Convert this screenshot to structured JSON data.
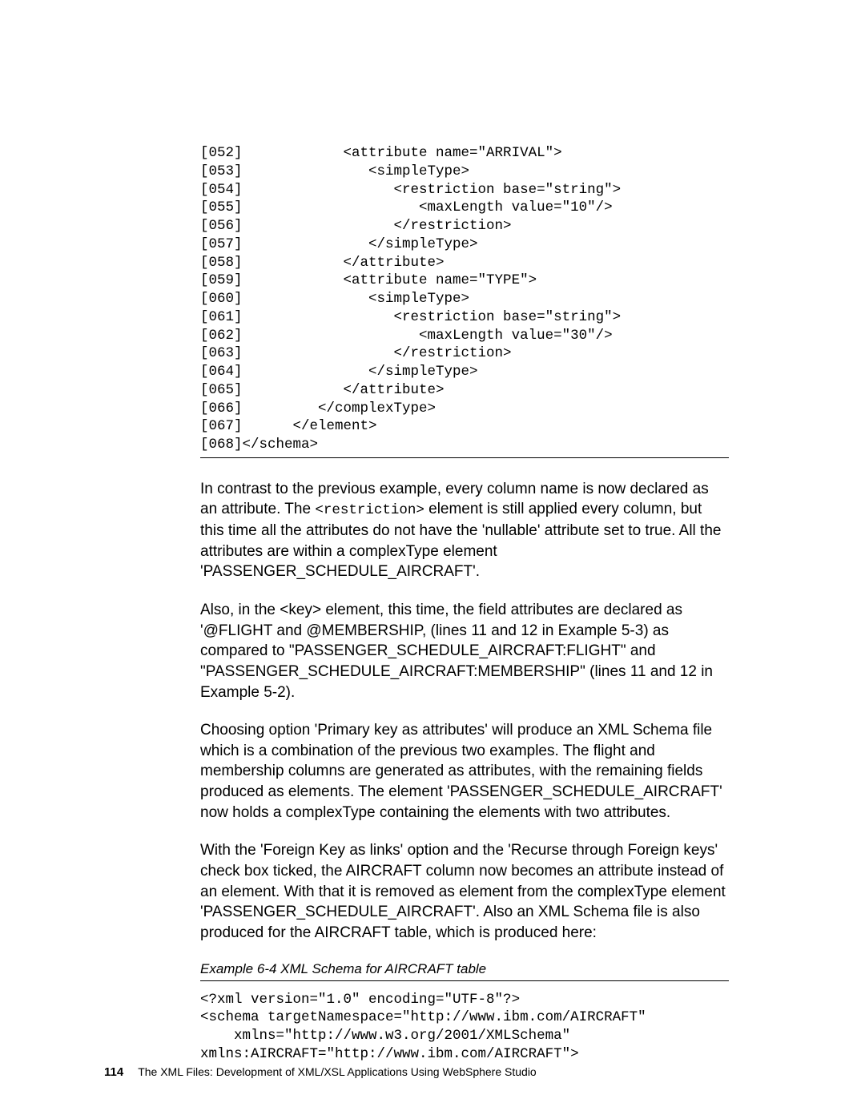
{
  "code1": "[052]            <attribute name=\"ARRIVAL\">\n[053]               <simpleType>\n[054]                  <restriction base=\"string\">\n[055]                     <maxLength value=\"10\"/>\n[056]                  </restriction>\n[057]               </simpleType>\n[058]            </attribute>\n[059]            <attribute name=\"TYPE\">\n[060]               <simpleType>\n[061]                  <restriction base=\"string\">\n[062]                     <maxLength value=\"30\"/>\n[063]                  </restriction>\n[064]               </simpleType>\n[065]            </attribute>\n[066]         </complexType>\n[067]      </element>\n[068]</schema>",
  "p1a": "In contrast to the previous example, every column name is now declared as an attribute. The ",
  "p1_code": "<restriction>",
  "p1b": " element is still applied every column, but this time all the attributes do not have the 'nullable' attribute set to true. All the attributes are within a complexType element 'PASSENGER_SCHEDULE_AIRCRAFT'.",
  "p2": "Also, in the <key> element, this time, the field attributes are declared as '@FLIGHT and @MEMBERSHIP, (lines 11 and 12 in Example 5-3) as compared to \"PASSENGER_SCHEDULE_AIRCRAFT:FLIGHT\" and \"PASSENGER_SCHEDULE_AIRCRAFT:MEMBERSHIP\" (lines 11 and 12 in Example 5-2).",
  "p3": "Choosing option 'Primary key as attributes' will produce an XML Schema file which is a combination of the previous two examples. The flight and membership columns are generated as attributes, with the remaining fields produced as elements. The element 'PASSENGER_SCHEDULE_AIRCRAFT' now holds a complexType containing the elements with two attributes.",
  "p4": "With the 'Foreign Key as links' option and the 'Recurse through Foreign keys' check box ticked, the AIRCRAFT column now becomes an attribute instead of an element. With that it is removed as element from the complexType element 'PASSENGER_SCHEDULE_AIRCRAFT'. Also an XML Schema file is also produced for the AIRCRAFT table, which is produced here:",
  "example_caption": "Example 6-4   XML Schema for AIRCRAFT table",
  "code2": "<?xml version=\"1.0\" encoding=\"UTF-8\"?>\n<schema targetNamespace=\"http://www.ibm.com/AIRCRAFT\"\n    xmlns=\"http://www.w3.org/2001/XMLSchema\"\nxmlns:AIRCRAFT=\"http://www.ibm.com/AIRCRAFT\">",
  "footer": {
    "page": "114",
    "title": "The XML Files:  Development of XML/XSL Applications Using WebSphere Studio"
  }
}
